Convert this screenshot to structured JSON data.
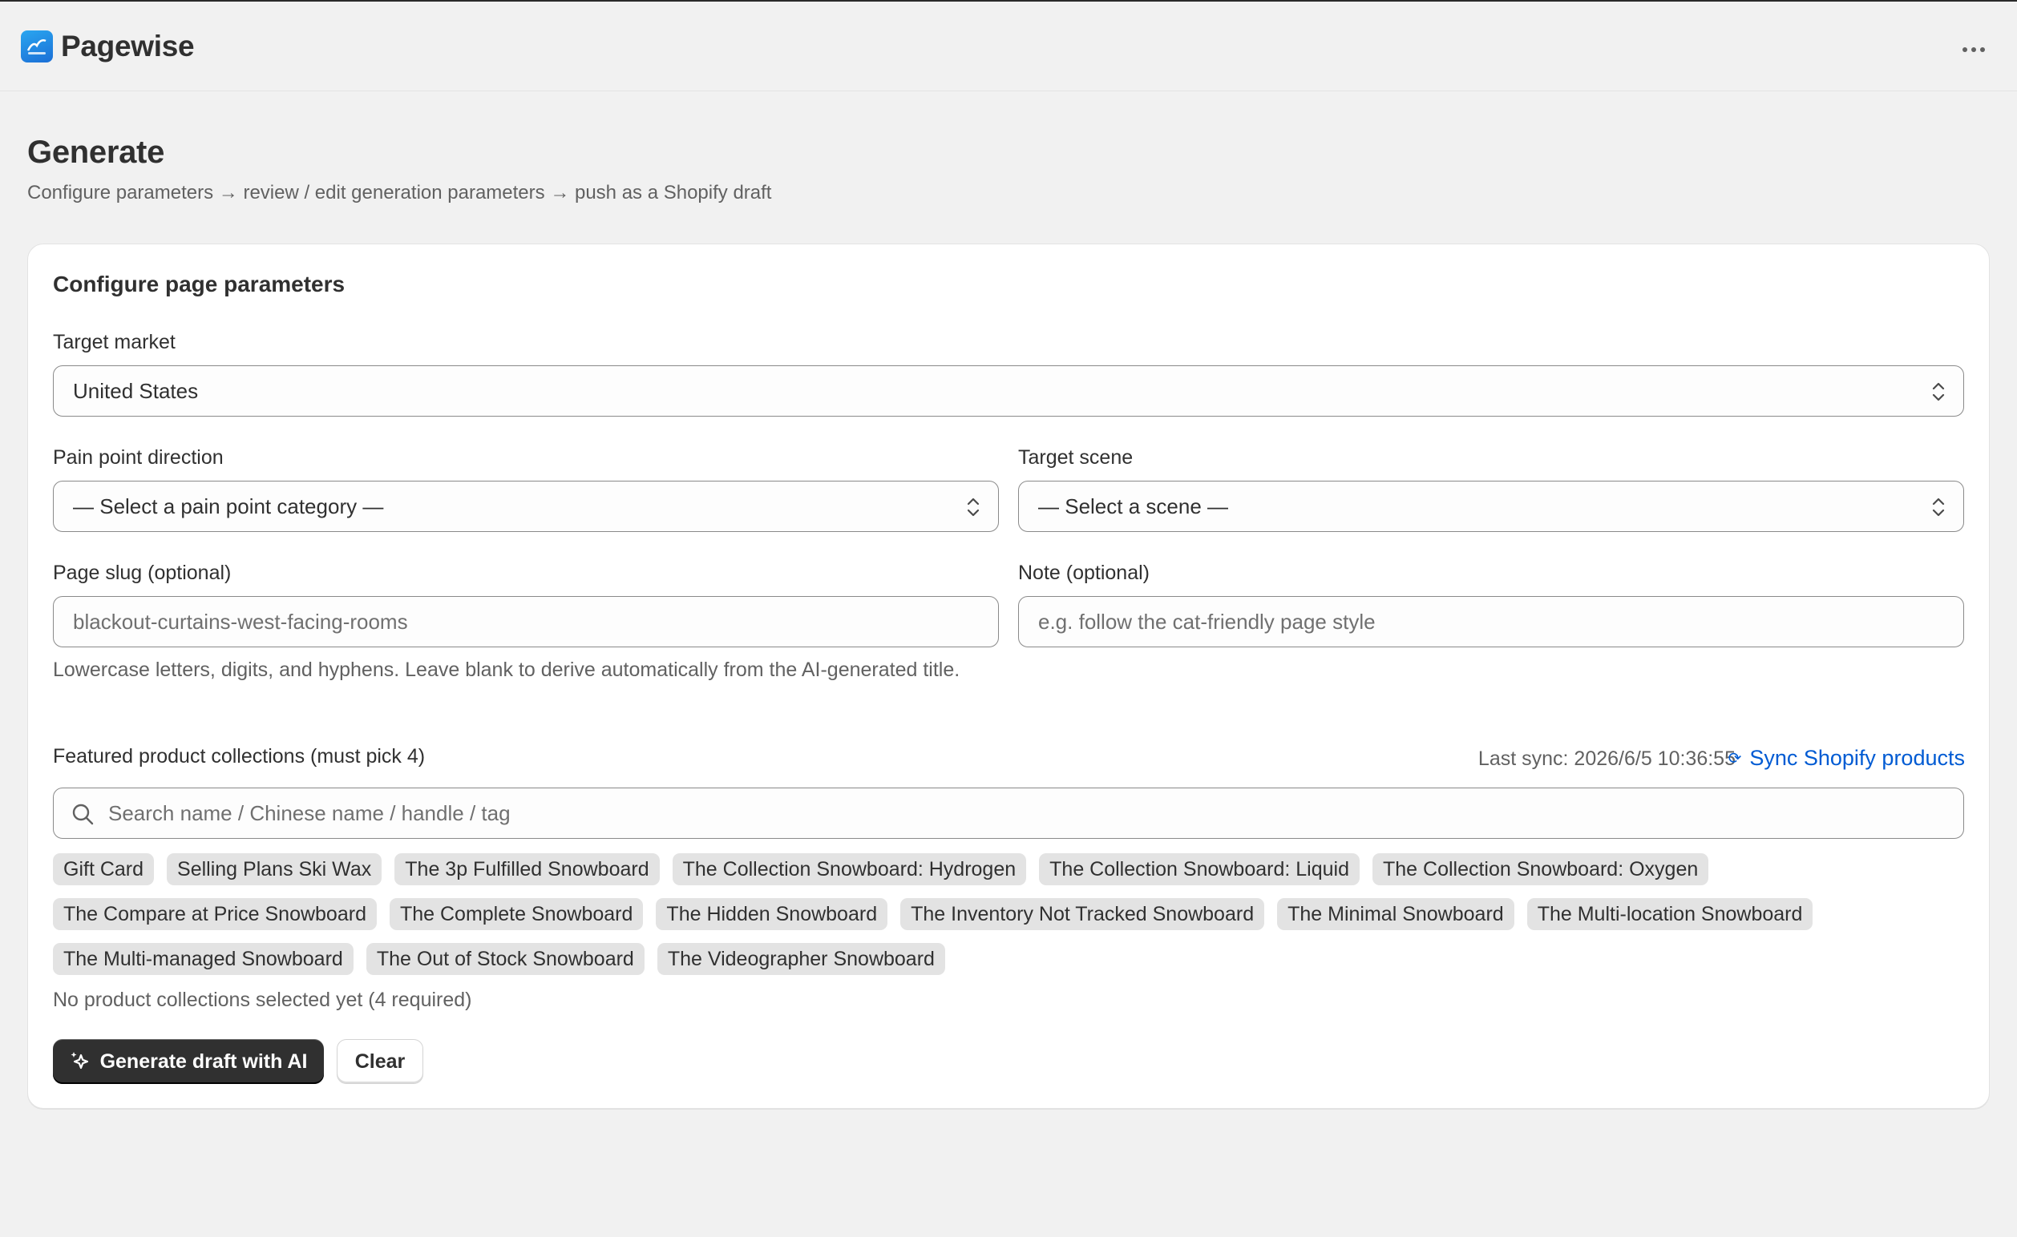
{
  "app": {
    "name": "Pagewise",
    "icon": "pagewise-logo",
    "menu_icon": "more-horizontal-icon"
  },
  "page": {
    "title": "Generate",
    "subtitle": "Configure parameters → review / edit generation parameters → push as a Shopify draft"
  },
  "card": {
    "title": "Configure page parameters",
    "target_market": {
      "label": "Target market",
      "value": "United States"
    },
    "pain_point": {
      "label": "Pain point direction",
      "value": "— Select a pain point category —"
    },
    "scene": {
      "label": "Target scene",
      "value": "— Select a scene —"
    },
    "slug": {
      "label": "Page slug (optional)",
      "value": "blackout-curtains-west-facing-rooms",
      "help": "Lowercase letters, digits, and hyphens. Leave blank to derive automatically from the AI-generated title."
    },
    "note": {
      "label": "Note (optional)",
      "placeholder": "e.g. follow the cat-friendly page style"
    },
    "collections": {
      "label": "Featured product collections (must pick 4)",
      "last_sync": "Last sync: 2026/6/5 10:36:55",
      "sync_link": "Sync Shopify products",
      "sync_icon": "⟳",
      "search_placeholder": "Search name / Chinese name / handle / tag",
      "rows": [
        [
          "Gift Card",
          "Selling Plans Ski Wax",
          "The 3p Fulfilled Snowboard",
          "The Collection Snowboard: Hydrogen",
          "The Collection Snowboard: Liquid",
          "The Collection Snowboard: Oxygen"
        ],
        [
          "The Compare at Price Snowboard",
          "The Complete Snowboard",
          "The Hidden Snowboard",
          "The Inventory Not Tracked Snowboard",
          "The Minimal Snowboard",
          "The Multi-location Snowboard"
        ],
        [
          "The Multi-managed Snowboard",
          "The Out of Stock Snowboard",
          "The Videographer Snowboard"
        ]
      ],
      "empty_note": "No product collections selected yet (4 required)"
    },
    "actions": {
      "generate": "Generate draft with AI",
      "clear": "Clear"
    }
  },
  "colors": {
    "accent_link": "#005bd3",
    "primary_button": "#303030",
    "background": "#f1f1f1"
  }
}
